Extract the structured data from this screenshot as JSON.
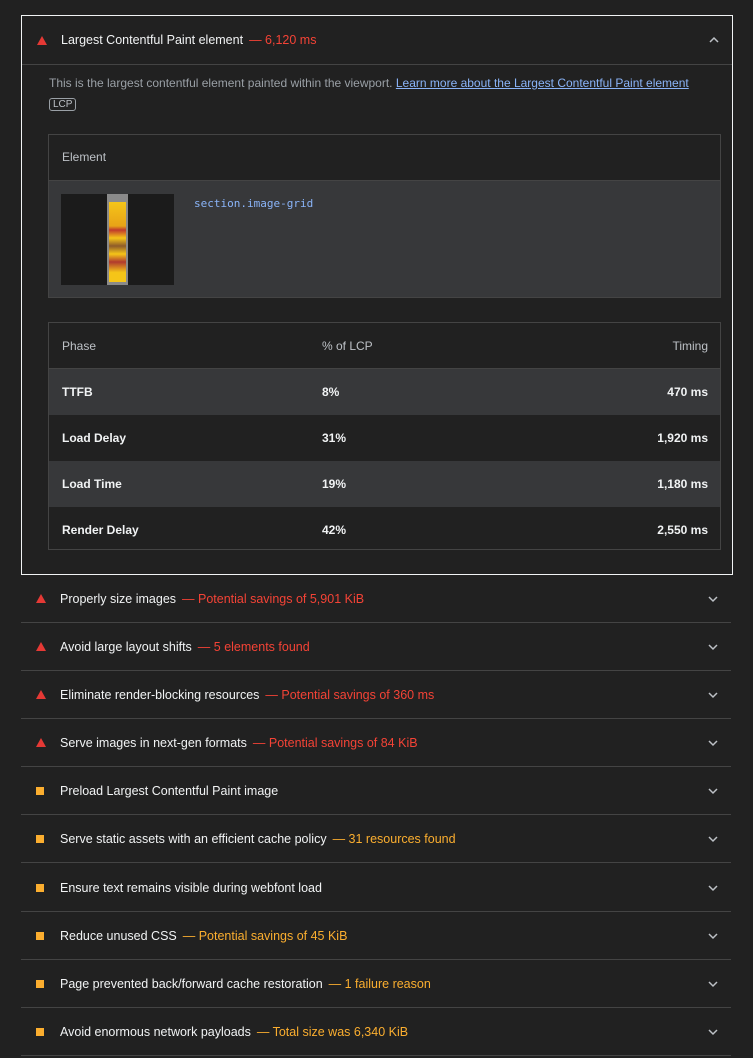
{
  "lcp_audit": {
    "title": "Largest Contentful Paint element",
    "display_value": "— 6,120 ms",
    "description": "This is the largest contentful element painted within the viewport.",
    "learn_more_link": "Learn more about the Largest Contentful Paint element",
    "badge": "LCP",
    "element_table": {
      "header": "Element",
      "selector": "section.image-grid"
    },
    "phase_table": {
      "headers": [
        "Phase",
        "% of LCP",
        "Timing"
      ],
      "rows": [
        {
          "phase": "TTFB",
          "percent": "8%",
          "timing": "470 ms"
        },
        {
          "phase": "Load Delay",
          "percent": "31%",
          "timing": "1,920 ms"
        },
        {
          "phase": "Load Time",
          "percent": "19%",
          "timing": "1,180 ms"
        },
        {
          "phase": "Render Delay",
          "percent": "42%",
          "timing": "2,550 ms"
        }
      ]
    }
  },
  "audits": [
    {
      "title": "Properly size images",
      "display_value": "— Potential savings of 5,901 KiB",
      "severity": "fail"
    },
    {
      "title": "Avoid large layout shifts",
      "display_value": "— 5 elements found",
      "severity": "fail"
    },
    {
      "title": "Eliminate render-blocking resources",
      "display_value": "— Potential savings of 360 ms",
      "severity": "fail"
    },
    {
      "title": "Serve images in next-gen formats",
      "display_value": "— Potential savings of 84 KiB",
      "severity": "fail"
    },
    {
      "title": "Preload Largest Contentful Paint image",
      "display_value": "",
      "severity": "average"
    },
    {
      "title": "Serve static assets with an efficient cache policy",
      "display_value": "— 31 resources found",
      "severity": "average"
    },
    {
      "title": "Ensure text remains visible during webfont load",
      "display_value": "",
      "severity": "average"
    },
    {
      "title": "Reduce unused CSS",
      "display_value": "— Potential savings of 45 KiB",
      "severity": "average"
    },
    {
      "title": "Page prevented back/forward cache restoration",
      "display_value": "— 1 failure reason",
      "severity": "average"
    },
    {
      "title": "Avoid enormous network payloads",
      "display_value": "— Total size was 6,340 KiB",
      "severity": "average"
    }
  ],
  "colors": {
    "fail": "#f44336",
    "average": "#fbae2f",
    "link": "#8ab4f8",
    "background": "#212121"
  },
  "icons": {
    "fail": "red-triangle-icon",
    "average": "orange-square-icon",
    "expand": "chevron-down-icon",
    "collapse": "chevron-up-icon"
  }
}
